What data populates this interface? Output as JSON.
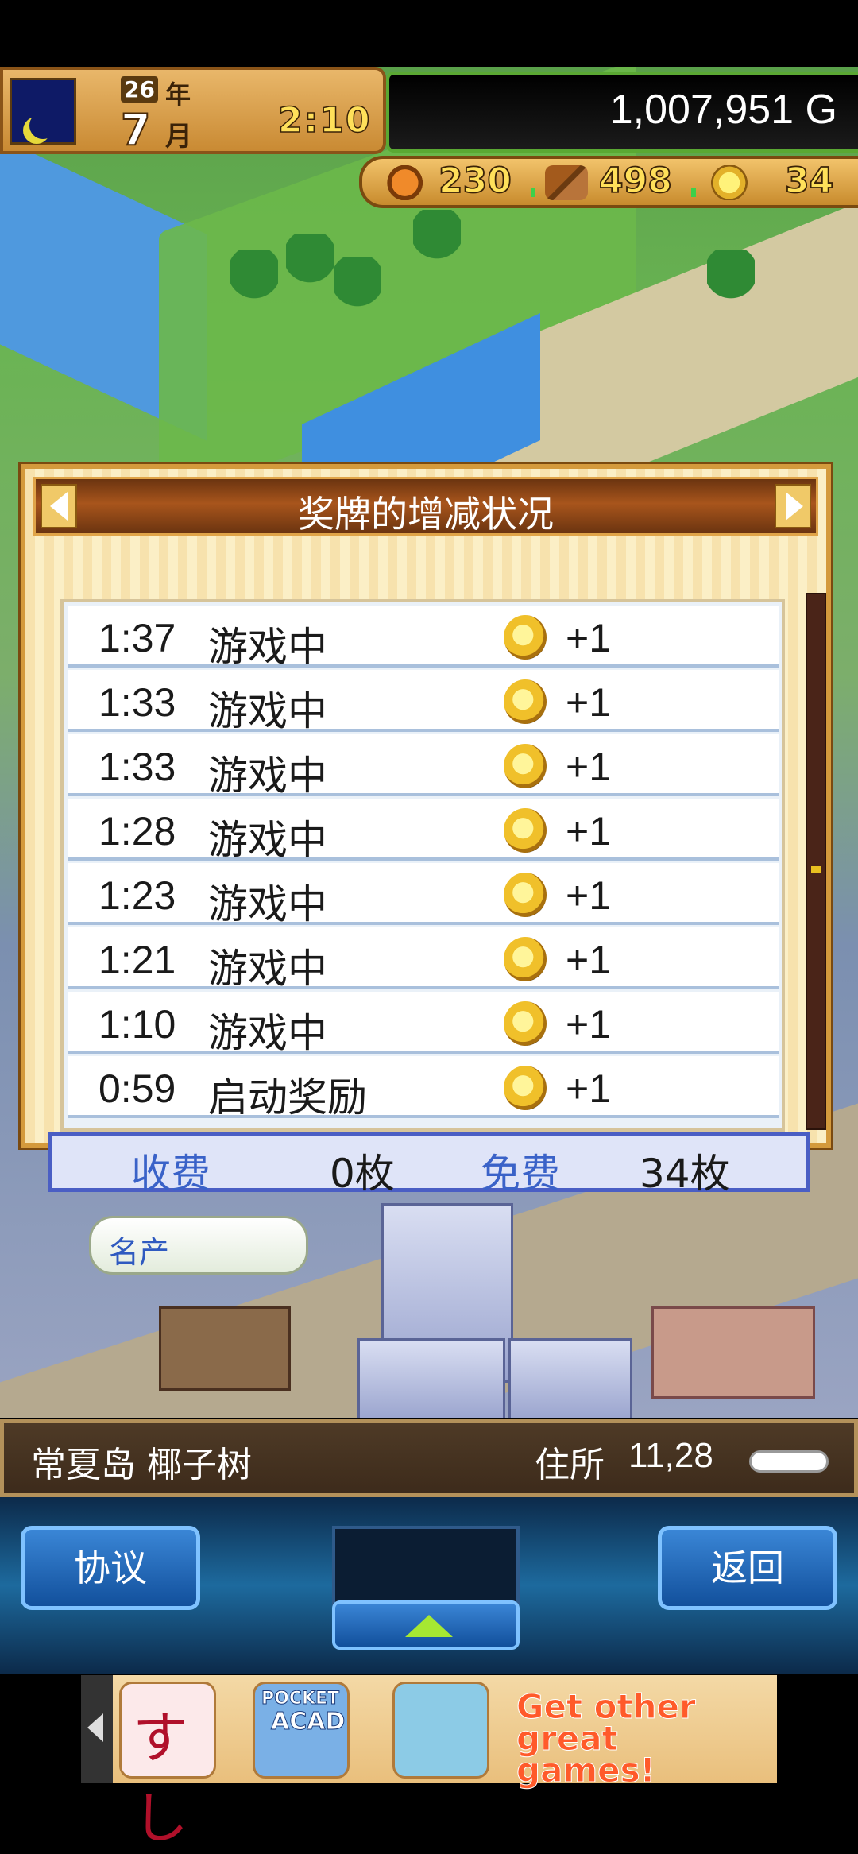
{
  "hud": {
    "year": "26",
    "year_unit": "年",
    "month": "7",
    "month_unit": "月",
    "clock": "2:10",
    "money": "1,007,951 G",
    "resources": {
      "food": "230",
      "wood": "498",
      "medals": "34"
    }
  },
  "dialog": {
    "title": "奖牌的增减状况",
    "rows": [
      {
        "time": "1:37",
        "label": "游戏中",
        "amount": "+1"
      },
      {
        "time": "1:33",
        "label": "游戏中",
        "amount": "+1"
      },
      {
        "time": "1:33",
        "label": "游戏中",
        "amount": "+1"
      },
      {
        "time": "1:28",
        "label": "游戏中",
        "amount": "+1"
      },
      {
        "time": "1:23",
        "label": "游戏中",
        "amount": "+1"
      },
      {
        "time": "1:21",
        "label": "游戏中",
        "amount": "+1"
      },
      {
        "time": "1:10",
        "label": "游戏中",
        "amount": "+1"
      },
      {
        "time": "0:59",
        "label": "启动奖励",
        "amount": "+1"
      }
    ],
    "summary": {
      "paid_label": "收费",
      "paid_value": "0枚",
      "free_label": "免费",
      "free_value": "34枚"
    }
  },
  "bubble": {
    "text": "名产"
  },
  "location": {
    "name": "常夏岛 椰子树",
    "address_label": "住所",
    "address_value": "11,28"
  },
  "controls": {
    "agree_label": "协议",
    "back_label": "返回"
  },
  "ad": {
    "app1_glyph": "すし",
    "app2_line1": "POCKET",
    "app2_line2": "ACAD",
    "cta": "Get other great games!"
  },
  "colors": {
    "hud_gold": "#ffe05a",
    "dialog_border": "#d49a3c",
    "summary_blue": "#3a62c8",
    "button_blue": "#12509c"
  }
}
